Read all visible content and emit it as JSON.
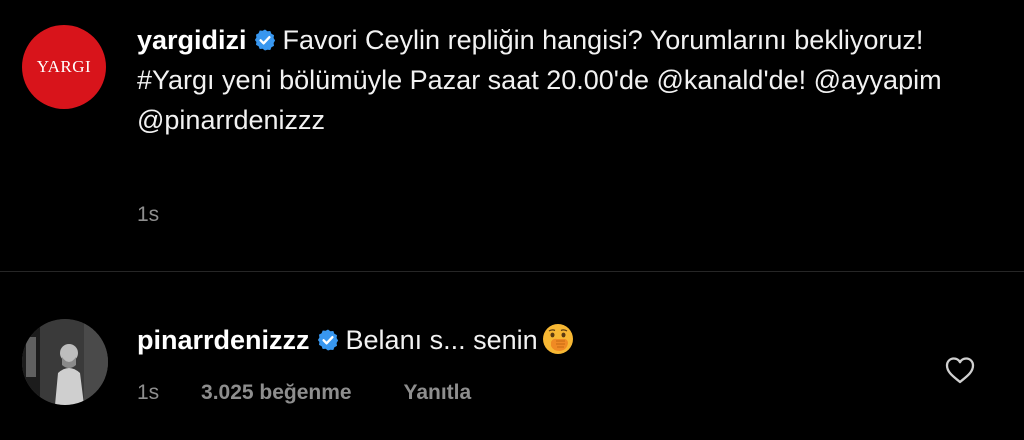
{
  "post": {
    "avatar_text": "YARGI",
    "username": "yargidizi",
    "text": "Favori Ceylin repliğin hangisi? Yorumlarını bekliyoruz! #Yargı yeni bölümüyle Pazar saat 20.00'de @kanald'de! @ayyapim @pinarrdenizzz",
    "time": "1s"
  },
  "comment": {
    "username": "pinarrdenizzz",
    "text": "Belanı s... senin",
    "time": "1s",
    "likes": "3.025 beğenme",
    "reply_label": "Yanıtla"
  },
  "icons": {
    "verified": "verified-badge-icon",
    "emoji": "face-with-hand-over-mouth-emoji-icon",
    "like": "heart-outline-icon"
  },
  "colors": {
    "background": "#000000",
    "text": "#f2f2f2",
    "secondary_text": "#8e8e8e",
    "verified_blue": "#3897f0",
    "brand_red": "#d8141b"
  }
}
